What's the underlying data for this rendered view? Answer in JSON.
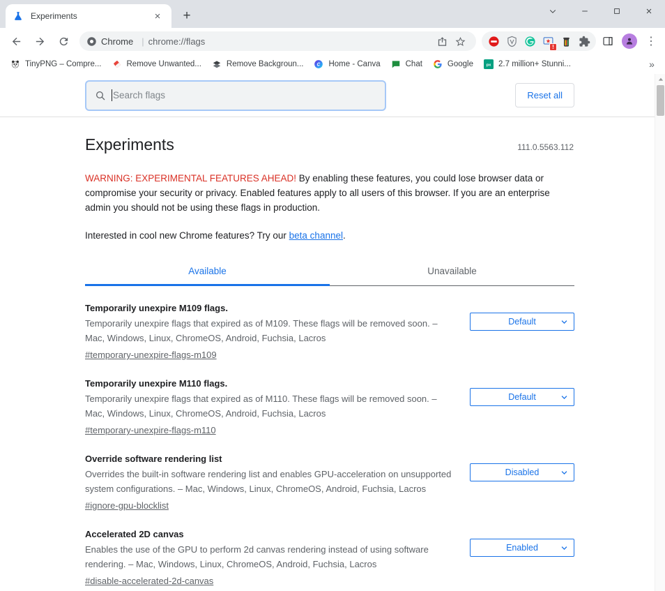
{
  "window": {
    "controls": {
      "tab_search": "tab-search",
      "minimize": "minimize",
      "maximize": "maximize",
      "close": "close"
    }
  },
  "tabstrip": {
    "tabs": [
      {
        "title": "Experiments",
        "favicon": "flask-icon"
      }
    ],
    "new_tab_label": "+",
    "close_label": "×"
  },
  "toolbar": {
    "back": "←",
    "forward": "→",
    "reload": "↻",
    "omnibox": {
      "brand": "Chrome",
      "separator": "|",
      "url": "chrome://flags",
      "share_icon": "share-icon",
      "bookmark_icon": "star-icon"
    },
    "extensions": [
      {
        "name": "adblock-extension",
        "badge": ""
      },
      {
        "name": "shield-extension",
        "badge": ""
      },
      {
        "name": "grammarly-extension",
        "badge": ""
      },
      {
        "name": "screenshot-extension",
        "badge": "!"
      },
      {
        "name": "trash-extension",
        "badge": ""
      },
      {
        "name": "puzzle-extensions-menu",
        "badge": ""
      }
    ],
    "side_panel": "side-panel-icon",
    "avatar": "profile-avatar",
    "menu": "⋮"
  },
  "bookmarks": {
    "items": [
      {
        "label": "TinyPNG – Compre...",
        "icon": "panda-icon"
      },
      {
        "label": "Remove Unwanted...",
        "icon": "eraser-icon"
      },
      {
        "label": "Remove Backgroun...",
        "icon": "layers-icon"
      },
      {
        "label": "Home - Canva",
        "icon": "canva-icon"
      },
      {
        "label": "Chat",
        "icon": "chat-icon"
      },
      {
        "label": "Google",
        "icon": "google-icon"
      },
      {
        "label": "2.7 million+ Stunni...",
        "icon": "pexels-icon"
      }
    ],
    "overflow_label": "»"
  },
  "search": {
    "placeholder": "Search flags",
    "value": "",
    "icon": "search-icon"
  },
  "reset": {
    "label": "Reset all"
  },
  "page": {
    "title": "Experiments",
    "version": "111.0.5563.112",
    "warning_strong": "WARNING: EXPERIMENTAL FEATURES AHEAD!",
    "warning_body": " By enabling these features, you could lose browser data or compromise your security or privacy. Enabled features apply to all users of this browser. If you are an enterprise admin you should not be using these flags in production.",
    "beta_prefix": "Interested in cool new Chrome features? Try our ",
    "beta_link": "beta channel",
    "beta_suffix": "."
  },
  "tabs": [
    {
      "label": "Available",
      "active": true
    },
    {
      "label": "Unavailable",
      "active": false
    }
  ],
  "flags": [
    {
      "name": "Temporarily unexpire M109 flags.",
      "description": "Temporarily unexpire flags that expired as of M109. These flags will be removed soon. – Mac, Windows, Linux, ChromeOS, Android, Fuchsia, Lacros",
      "id": "#temporary-unexpire-flags-m109",
      "value": "Default"
    },
    {
      "name": "Temporarily unexpire M110 flags.",
      "description": "Temporarily unexpire flags that expired as of M110. These flags will be removed soon. – Mac, Windows, Linux, ChromeOS, Android, Fuchsia, Lacros",
      "id": "#temporary-unexpire-flags-m110",
      "value": "Default"
    },
    {
      "name": "Override software rendering list",
      "description": "Overrides the built-in software rendering list and enables GPU-acceleration on unsupported system configurations. – Mac, Windows, Linux, ChromeOS, Android, Fuchsia, Lacros",
      "id": "#ignore-gpu-blocklist",
      "value": "Disabled"
    },
    {
      "name": "Accelerated 2D canvas",
      "description": "Enables the use of the GPU to perform 2d canvas rendering instead of using software rendering. – Mac, Windows, Linux, ChromeOS, Android, Fuchsia, Lacros",
      "id": "#disable-accelerated-2d-canvas",
      "value": "Enabled"
    }
  ],
  "colors": {
    "accent": "#1a73e8",
    "warning": "#d93025",
    "chrome_bg": "#dee1e6"
  }
}
